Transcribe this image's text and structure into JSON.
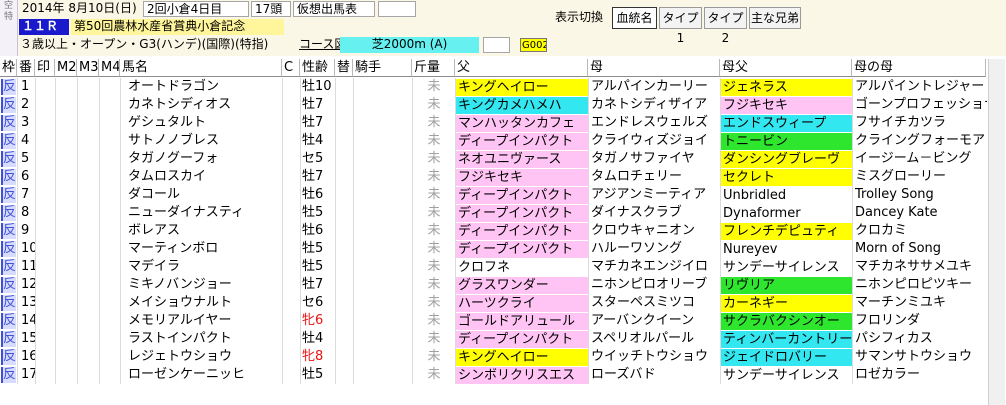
{
  "header": {
    "date": "2014年 8月10日(日)",
    "meeting": "2回小倉4日目",
    "heads": "17頭",
    "mode": "仮想出馬表",
    "race_no": "１１Ｒ",
    "race_name": "第50回農林水産省賞典小倉記念",
    "conditions": "３歳以上・オープン・G3(ハンデ)(国際)(特指)",
    "course_label": "コース図",
    "course": "芝2000m (A)",
    "grade": "G002",
    "side_glyphs": [
      "空",
      "特"
    ]
  },
  "toolbar": {
    "label": "表示切換",
    "buttons": [
      "血統名",
      "タイプ1",
      "タイプ2",
      "主な兄弟"
    ],
    "active": "血統名"
  },
  "columns": [
    "枠",
    "番",
    "印",
    "M2",
    "M3",
    "M4",
    "馬名",
    "C",
    "性齢",
    "替",
    "騎手",
    "斤量",
    "父",
    "母",
    "母父",
    "母の母"
  ],
  "colors": {
    "yellow": "#ffff00",
    "cyan": "#33e7f0",
    "pink": "#ffc4f4",
    "green": "#2ee62e",
    "gate_blue": "#3f4fd6",
    "weight_gray": "#a0a0a0",
    "female_red": "#ee1111"
  },
  "rows": [
    {
      "waku": "反",
      "ban": "1",
      "name": "オートドラゴン",
      "sex": "牡10",
      "kinryo": "未",
      "sire": "キングヘイロー",
      "sire_bg": "yellow",
      "dam": "アルパインカーリー",
      "dam_bg": "",
      "bms": "ジェネラス",
      "bms_bg": "yellow",
      "damdam": "アルパイントレジャー",
      "damdam_bg": ""
    },
    {
      "waku": "反",
      "ban": "2",
      "name": "カネトシディオス",
      "sex": "牡7",
      "kinryo": "未",
      "sire": "キングカメハメハ",
      "sire_bg": "cyan",
      "dam": "カネトシディザイア",
      "dam_bg": "",
      "bms": "フジキセキ",
      "bms_bg": "pink",
      "damdam": "ゴーンプロフェッショナ",
      "damdam_bg": ""
    },
    {
      "waku": "反",
      "ban": "3",
      "name": "ゲシュタルト",
      "sex": "牡7",
      "kinryo": "未",
      "sire": "マンハッタンカフェ",
      "sire_bg": "pink",
      "dam": "エンドレスウェルズ",
      "dam_bg": "",
      "bms": "エンドスウィープ",
      "bms_bg": "cyan",
      "damdam": "フサイチカツラ",
      "damdam_bg": ""
    },
    {
      "waku": "反",
      "ban": "4",
      "name": "サトノノブレス",
      "sex": "牡4",
      "kinryo": "未",
      "sire": "ディープインパクト",
      "sire_bg": "pink",
      "dam": "クライウィズジョイ",
      "dam_bg": "",
      "bms": "トニービン",
      "bms_bg": "green",
      "damdam": "クライングフォーモア",
      "damdam_bg": ""
    },
    {
      "waku": "反",
      "ban": "5",
      "name": "タガノグーフォ",
      "sex": "セ5",
      "kinryo": "未",
      "sire": "ネオユニヴァース",
      "sire_bg": "pink",
      "dam": "タガノサファイヤ",
      "dam_bg": "",
      "bms": "ダンシングブレーヴ",
      "bms_bg": "yellow",
      "damdam": "イージーム－ビング",
      "damdam_bg": ""
    },
    {
      "waku": "反",
      "ban": "6",
      "name": "タムロスカイ",
      "sex": "牡7",
      "kinryo": "未",
      "sire": "フジキセキ",
      "sire_bg": "pink",
      "dam": "タムロチェリー",
      "dam_bg": "",
      "bms": "セクレト",
      "bms_bg": "yellow",
      "damdam": "ミスグローリー",
      "damdam_bg": ""
    },
    {
      "waku": "反",
      "ban": "7",
      "name": "ダコール",
      "sex": "牡6",
      "kinryo": "未",
      "sire": "ディープインパクト",
      "sire_bg": "pink",
      "dam": "アジアンミーティア",
      "dam_bg": "",
      "bms": "Unbridled",
      "bms_bg": "",
      "damdam": "Trolley Song",
      "damdam_bg": ""
    },
    {
      "waku": "反",
      "ban": "8",
      "name": "ニューダイナスティ",
      "sex": "牡5",
      "kinryo": "未",
      "sire": "ディープインパクト",
      "sire_bg": "pink",
      "dam": "ダイナスクラブ",
      "dam_bg": "",
      "bms": "Dynaformer",
      "bms_bg": "",
      "damdam": "Dancey Kate",
      "damdam_bg": ""
    },
    {
      "waku": "反",
      "ban": "9",
      "name": "ボレアス",
      "sex": "牡6",
      "kinryo": "未",
      "sire": "ディープインパクト",
      "sire_bg": "pink",
      "dam": "クロウキャニオン",
      "dam_bg": "",
      "bms": "フレンチデピュティ",
      "bms_bg": "yellow",
      "damdam": "クロカミ",
      "damdam_bg": ""
    },
    {
      "waku": "反",
      "ban": "10",
      "name": "マーティンボロ",
      "sex": "牡5",
      "kinryo": "未",
      "sire": "ディープインパクト",
      "sire_bg": "pink",
      "dam": "ハルーワソング",
      "dam_bg": "",
      "bms": "Nureyev",
      "bms_bg": "",
      "damdam": "Morn of Song",
      "damdam_bg": ""
    },
    {
      "waku": "反",
      "ban": "11",
      "name": "マデイラ",
      "sex": "牡5",
      "kinryo": "未",
      "sire": "クロフネ",
      "sire_bg": "",
      "dam": "マチカネエンジイロ",
      "dam_bg": "",
      "bms": "サンデーサイレンス",
      "bms_bg": "",
      "damdam": "マチカネササメユキ",
      "damdam_bg": ""
    },
    {
      "waku": "反",
      "ban": "12",
      "name": "ミキノバンジョー",
      "sex": "牡7",
      "kinryo": "未",
      "sire": "グラスワンダー",
      "sire_bg": "pink",
      "dam": "ニホンピロオリーブ",
      "dam_bg": "",
      "bms": "リヴリア",
      "bms_bg": "green",
      "damdam": "ニホンピロピツキー",
      "damdam_bg": ""
    },
    {
      "waku": "反",
      "ban": "13",
      "name": "メイショウナルト",
      "sex": "セ6",
      "kinryo": "未",
      "sire": "ハーツクライ",
      "sire_bg": "pink",
      "dam": "スターペスミツコ",
      "dam_bg": "",
      "bms": "カーネギー",
      "bms_bg": "yellow",
      "damdam": "マーチンミユキ",
      "damdam_bg": ""
    },
    {
      "waku": "反",
      "ban": "14",
      "name": "メモリアルイヤー",
      "sex": "牝6",
      "kinryo": "未",
      "sire": "ゴールドアリュール",
      "sire_bg": "pink",
      "dam": "アーバンクイーン",
      "dam_bg": "",
      "bms": "サクラバクシンオー",
      "bms_bg": "green",
      "damdam": "フロリンダ",
      "damdam_bg": ""
    },
    {
      "waku": "反",
      "ban": "15",
      "name": "ラストインパクト",
      "sex": "牡4",
      "kinryo": "未",
      "sire": "ディープインパクト",
      "sire_bg": "pink",
      "dam": "スペリオルパール",
      "dam_bg": "",
      "bms": "ティンバーカントリー",
      "bms_bg": "cyan",
      "damdam": "パシフィカス",
      "damdam_bg": ""
    },
    {
      "waku": "反",
      "ban": "16",
      "name": "レジェトウショウ",
      "sex": "牝8",
      "kinryo": "未",
      "sire": "キングヘイロー",
      "sire_bg": "yellow",
      "dam": "ウイッチトウショウ",
      "dam_bg": "",
      "bms": "ジェイドロバリー",
      "bms_bg": "cyan",
      "damdam": "サマンサトウショウ",
      "damdam_bg": ""
    },
    {
      "waku": "反",
      "ban": "17",
      "name": "ローゼンケーニッヒ",
      "sex": "牡5",
      "kinryo": "未",
      "sire": "シンボリクリスエス",
      "sire_bg": "pink",
      "dam": "ローズバド",
      "dam_bg": "",
      "bms": "サンデーサイレンス",
      "bms_bg": "",
      "damdam": "ロゼカラー",
      "damdam_bg": ""
    }
  ]
}
